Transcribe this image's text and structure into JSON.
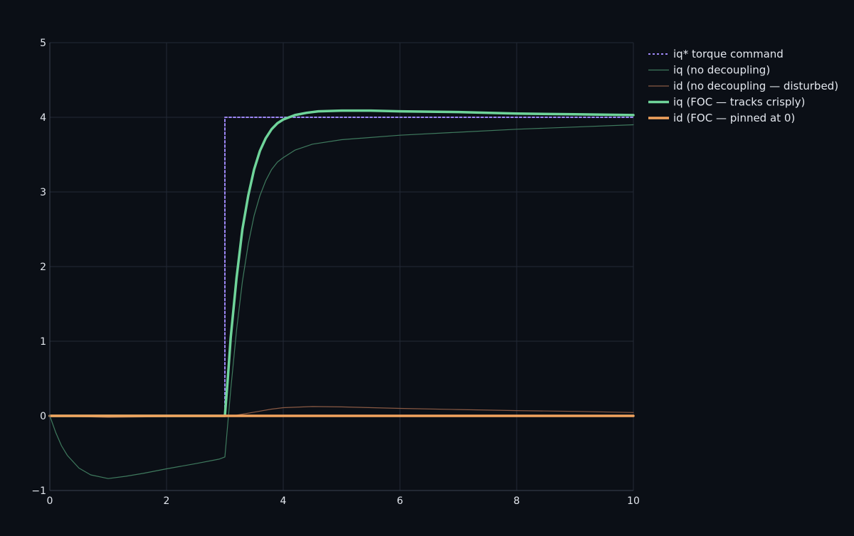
{
  "chart_data": {
    "type": "line",
    "title": "",
    "xlabel": "",
    "ylabel": "",
    "xlim": [
      0,
      10
    ],
    "ylim": [
      -1,
      5
    ],
    "xticks": [
      0,
      2,
      4,
      6,
      8,
      10
    ],
    "yticks": [
      -1,
      0,
      1,
      2,
      3,
      4,
      5
    ],
    "ytick_labels": [
      "−1",
      "0",
      "1",
      "2",
      "3",
      "4",
      "5"
    ],
    "grid": true,
    "legend_position": "top-right, outside plot",
    "colors": {
      "background": "#0b0f16",
      "grid": "#232a36",
      "axis": "#3a4250",
      "tick_text": "#e3e7ee"
    },
    "series": [
      {
        "name": "iq* torque command",
        "color": "#9d87f5",
        "style": "dotted",
        "x": [
          0,
          3,
          3,
          10
        ],
        "y": [
          0,
          0,
          4,
          4
        ]
      },
      {
        "name": "iq  (no decoupling)",
        "color": "#3f7a5e",
        "style": "thin",
        "x": [
          0,
          0.1,
          0.2,
          0.3,
          0.5,
          0.7,
          1.0,
          1.3,
          1.6,
          2.0,
          2.5,
          2.9,
          3.0,
          3.1,
          3.2,
          3.3,
          3.4,
          3.5,
          3.6,
          3.7,
          3.8,
          3.9,
          4.0,
          4.2,
          4.5,
          5.0,
          6.0,
          7.0,
          8.0,
          9.0,
          10.0
        ],
        "y": [
          0,
          -0.22,
          -0.4,
          -0.53,
          -0.7,
          -0.79,
          -0.84,
          -0.81,
          -0.77,
          -0.71,
          -0.64,
          -0.58,
          -0.55,
          0.35,
          1.15,
          1.8,
          2.3,
          2.68,
          2.95,
          3.15,
          3.3,
          3.4,
          3.46,
          3.56,
          3.64,
          3.7,
          3.76,
          3.8,
          3.84,
          3.87,
          3.9
        ]
      },
      {
        "name": "id  (no decoupling — disturbed)",
        "color": "#8a5a44",
        "style": "thin",
        "x": [
          0,
          0.5,
          1.0,
          2.0,
          3.0,
          3.2,
          3.5,
          3.8,
          4.0,
          4.5,
          5.0,
          6.0,
          7.0,
          8.0,
          9.0,
          10.0
        ],
        "y": [
          0,
          -0.01,
          -0.02,
          -0.01,
          0,
          0.01,
          0.05,
          0.09,
          0.11,
          0.125,
          0.12,
          0.1,
          0.085,
          0.07,
          0.06,
          0.045
        ]
      },
      {
        "name": "iq  (FOC — tracks crisply)",
        "color": "#6fd49a",
        "style": "thick",
        "x": [
          0,
          2.5,
          3.0,
          3.05,
          3.1,
          3.2,
          3.3,
          3.4,
          3.5,
          3.6,
          3.7,
          3.8,
          3.9,
          4.0,
          4.2,
          4.4,
          4.6,
          4.8,
          5.0,
          5.5,
          6.0,
          7.0,
          8.0,
          9.0,
          10.0
        ],
        "y": [
          0,
          0,
          0,
          0.5,
          1.05,
          1.85,
          2.5,
          2.95,
          3.3,
          3.55,
          3.72,
          3.84,
          3.92,
          3.97,
          4.03,
          4.06,
          4.08,
          4.085,
          4.09,
          4.09,
          4.08,
          4.07,
          4.05,
          4.04,
          4.03
        ]
      },
      {
        "name": "id  (FOC — pinned at 0)",
        "color": "#f2a35e",
        "style": "thick",
        "x": [
          0,
          10
        ],
        "y": [
          0,
          0
        ]
      }
    ]
  }
}
